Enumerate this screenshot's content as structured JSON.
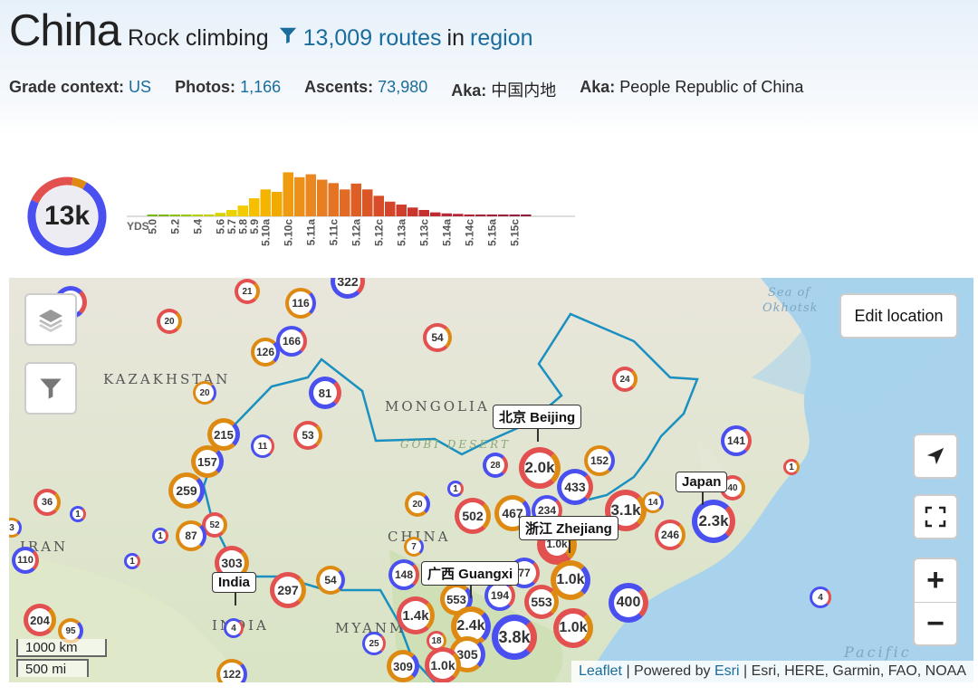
{
  "header": {
    "country": "China",
    "subtitle": "Rock climbing",
    "routes": "13,009 routes",
    "in_text": "in",
    "region": "region"
  },
  "meta": [
    {
      "label": "Grade context:",
      "value": "US",
      "link": true
    },
    {
      "label": "Photos:",
      "value": "1,166",
      "link": true
    },
    {
      "label": "Ascents:",
      "value": "73,980",
      "link": true
    },
    {
      "label": "Aka:",
      "value": "中国内地",
      "link": false
    },
    {
      "label": "Aka:",
      "value": "People Republic of China",
      "link": false
    }
  ],
  "summary": {
    "total": "13k",
    "colors": {
      "primary": "#4a4ff0",
      "secondary": "#e2504f",
      "tertiary": "#de8a12"
    }
  },
  "chart_data": {
    "type": "bar",
    "xlabel": "YDS",
    "categories": [
      "5.0",
      "5.1",
      "5.2",
      "5.3",
      "5.4",
      "5.5",
      "5.6",
      "5.7",
      "5.8",
      "5.9",
      "5.10a",
      "5.10b",
      "5.10c",
      "5.10d",
      "5.11a",
      "5.11b",
      "5.11c",
      "5.11d",
      "5.12a",
      "5.12b",
      "5.12c",
      "5.12d",
      "5.13a",
      "5.13b",
      "5.13c",
      "5.13d",
      "5.14a",
      "5.14b",
      "5.14c",
      "5.14d",
      "5.15a",
      "5.15b",
      "5.15c",
      "5.15d"
    ],
    "tick_labels": [
      "5.0",
      "5.2",
      "5.4",
      "5.6",
      "5.7",
      "5.8",
      "5.9",
      "5.10a",
      "5.10c",
      "5.11a",
      "5.11c",
      "5.12a",
      "5.12c",
      "5.13a",
      "5.13c",
      "5.14a",
      "5.14c",
      "5.15a",
      "5.15c"
    ],
    "values": [
      0.02,
      0.02,
      0.02,
      0.02,
      0.03,
      0.03,
      0.07,
      0.13,
      0.22,
      0.37,
      0.55,
      0.5,
      0.9,
      0.8,
      0.86,
      0.75,
      0.68,
      0.55,
      0.67,
      0.55,
      0.42,
      0.3,
      0.24,
      0.18,
      0.13,
      0.08,
      0.06,
      0.05,
      0.03,
      0.02,
      0.02,
      0.01,
      0.01,
      0.01
    ],
    "colors": [
      "#7cb518",
      "#7cb518",
      "#8cc20f",
      "#9ac70a",
      "#b5cf06",
      "#c9d000",
      "#d9d000",
      "#ead300",
      "#f2cc00",
      "#f6c000",
      "#f5b400",
      "#f3aa00",
      "#ef9a10",
      "#ec9018",
      "#ea8720",
      "#e77e22",
      "#e47424",
      "#e16a25",
      "#de5f26",
      "#db5626",
      "#d84d28",
      "#d4452a",
      "#cf3d2c",
      "#ca362d",
      "#c5302f",
      "#c02b30",
      "#bb2732",
      "#b62433",
      "#b02234",
      "#aa2035",
      "#a41e36",
      "#9e1d37",
      "#981c38",
      "#921b39"
    ]
  },
  "map": {
    "edit_location": "Edit location",
    "zoom_in": "+",
    "zoom_out": "−",
    "attribution": {
      "leaflet": "Leaflet",
      "powered": "| Powered by",
      "esri": "Esri",
      "rest": "| Esri, HERE, Garmin, FAO, NOAA"
    },
    "scale": {
      "km": "1000 km",
      "mi": "500 mi"
    },
    "labels": {
      "kazakhstan": "KAZAKHSTAN",
      "mongolia": "MONGOLIA",
      "gobi": "GOBI DESERT",
      "china": "CHINA",
      "iran": "IRAN",
      "india": "INDIA",
      "myanmar": "MYANM",
      "sea_okhotsk_1": "Sea of",
      "sea_okhotsk_2": "Okhotsk",
      "pacific": "Pacific"
    },
    "tags": [
      {
        "text": "北京 Beijing"
      },
      {
        "text": "Japan"
      },
      {
        "text": "浙江 Zhejiang"
      },
      {
        "text": "广西 Guangxi"
      },
      {
        "text": "India"
      }
    ],
    "clusters": [
      "4",
      "21",
      "116",
      "322",
      "20",
      "126",
      "166",
      "54",
      "20",
      "81",
      "24",
      "215",
      "11",
      "53",
      "157",
      "141",
      "1",
      "259",
      "28",
      "2.0k",
      "152",
      "433",
      "36",
      "20",
      "1",
      "502",
      "467",
      "234",
      "3.1k",
      "14",
      "2.3k",
      "40",
      "3",
      "1",
      "52",
      "87",
      "1",
      "246",
      "IRAN",
      "110",
      "303",
      "7",
      "148",
      "1.0k",
      "1.0k",
      "1",
      "297",
      "54",
      "194",
      "553",
      "553",
      "4",
      "1.4k",
      "2.4k",
      "400",
      "204",
      "95",
      "4",
      "18",
      "305",
      "3.8k",
      "1.0k",
      "309",
      "25",
      "1.0k",
      "122",
      "77",
      "1.0k"
    ]
  }
}
